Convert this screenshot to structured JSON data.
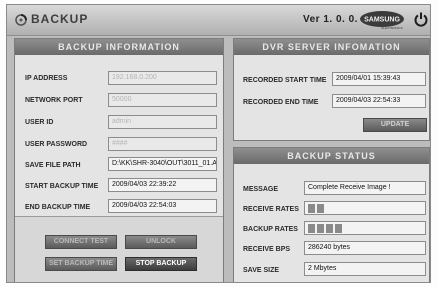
{
  "app": {
    "title": "BACKUP",
    "version": "Ver 1. 0. 0. 8",
    "brand": "SAMSUNG",
    "brand_sub": "ELECTRONICS"
  },
  "backup_info": {
    "header": "BACKUP INFORMATION",
    "ip_label": "IP ADDRESS",
    "ip_value": "192.168.0.200",
    "port_label": "NETWORK PORT",
    "port_value": "50000",
    "user_label": "USER ID",
    "user_value": "admin",
    "password_label": "USER PASSWORD",
    "password_value": "####",
    "path_label": "SAVE FILE PATH",
    "path_value": "D:\\KK\\SHR-3040\\OUT\\3011_01.A",
    "start_label": "START BACKUP TIME",
    "start_value": "2009/04/03 22:39:22",
    "end_label": "END BACKUP TIME",
    "end_value": "2009/04/03 22:54:03"
  },
  "buttons": {
    "connect_test": "CONNECT TEST",
    "unlock": "UNLOCK",
    "set_backup_time": "SET BACKUP TIME",
    "stop_backup": "STOP BACKUP"
  },
  "dvr_server": {
    "header": "DVR SERVER INFOMATION",
    "rec_start_label": "RECORDED START TIME",
    "rec_start_value": "2009/04/01 15:39:43",
    "rec_end_label": "RECORDED END TIME",
    "rec_end_value": "2009/04/03 22:54:33",
    "update_button": "UPDATE"
  },
  "backup_status": {
    "header": "BACKUP STATUS",
    "message_label": "MESSAGE",
    "message_value": "Complete Receive Image !",
    "receive_rates_label": "RECEIVE RATES",
    "receive_rates_segments": 2,
    "backup_rates_label": "BACKUP RATES",
    "backup_rates_segments": 4,
    "receive_bps_label": "RECEIVE BPS",
    "receive_bps_value": "286240 bytes",
    "save_size_label": "SAVE SIZE",
    "save_size_value": "2 Mbytes"
  },
  "colors": {
    "panel_header": "#6a6a6a",
    "panel_bg": "#e4e4e4",
    "progress_segment": "#8a8a8a"
  }
}
